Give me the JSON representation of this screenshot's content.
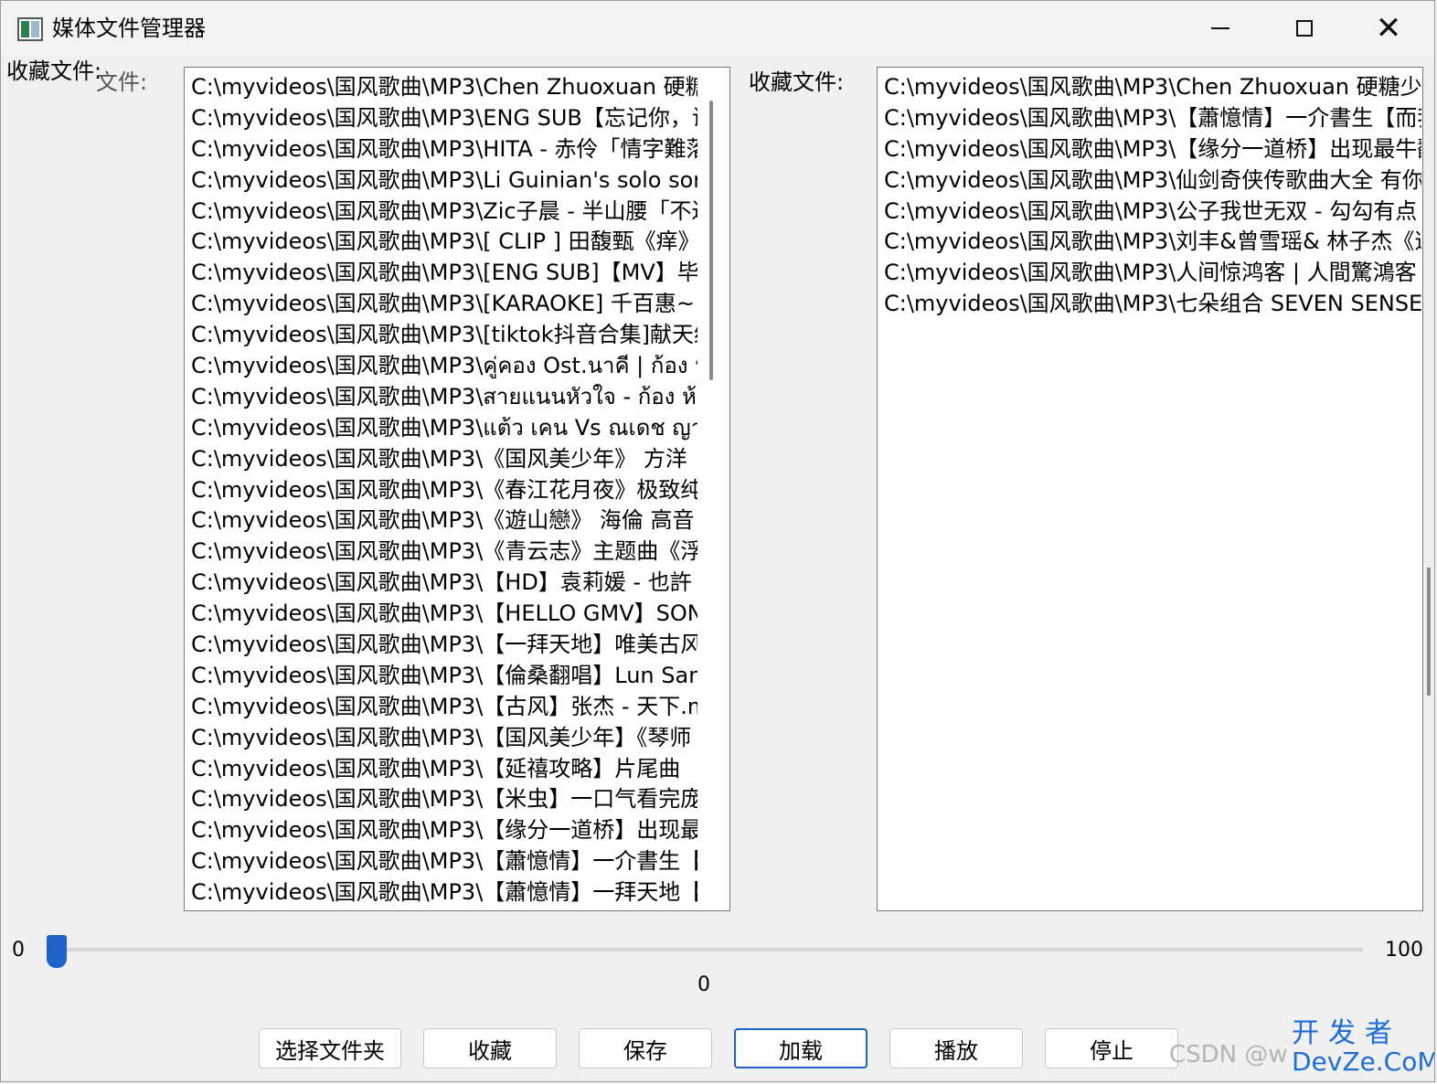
{
  "window": {
    "title": "媒体文件管理器",
    "minimize_label": "—",
    "maximize_label": "□",
    "close_label": "✕"
  },
  "left_panel": {
    "label": "收藏文件:",
    "label_ghost": "文件:",
    "items": [
      "C:\\myvideos\\国风歌曲\\MP3\\Chen Zhuoxuan 硬糖",
      "C:\\myvideos\\国风歌曲\\MP3\\ENG SUB【忘记你，说",
      "C:\\myvideos\\国风歌曲\\MP3\\HITA - 赤伶「情字難落",
      "C:\\myvideos\\国风歌曲\\MP3\\Li Guinian's solo son",
      "C:\\myvideos\\国风歌曲\\MP3\\Zic子晨 - 半山腰「不过",
      "C:\\myvideos\\国风歌曲\\MP3\\[ CLIP ] 田馥甄《痒》",
      "C:\\myvideos\\国风歌曲\\MP3\\[ENG SUB]【MV】毕",
      "C:\\myvideos\\国风歌曲\\MP3\\[KARAOKE] 千百惠~",
      "C:\\myvideos\\国风歌曲\\MP3\\[tiktok抖音合集]献天给",
      "C:\\myvideos\\国风歌曲\\MP3\\คู่คอง Ost.นาคี  |  ก้อง ห้",
      "C:\\myvideos\\国风歌曲\\MP3\\สายแนนหัวใจ - ก้อง ห้วยไร่",
      "C:\\myvideos\\国风歌曲\\MP3\\แต้ว เคน Vs ณเดช ญาญ่า",
      "C:\\myvideos\\国风歌曲\\MP3\\《国风美少年》  方洋",
      "C:\\myvideos\\国风歌曲\\MP3\\《春江花月夜》极致纯",
      "C:\\myvideos\\国风歌曲\\MP3\\《遊山戀》 海倫 高音",
      "C:\\myvideos\\国风歌曲\\MP3\\《青云志》主题曲《浮",
      "C:\\myvideos\\国风歌曲\\MP3\\【HD】袁莉媛 - 也許",
      "C:\\myvideos\\国风歌曲\\MP3\\【HELLO GMV】SON",
      "C:\\myvideos\\国风歌曲\\MP3\\【一拜天地】唯美古风",
      "C:\\myvideos\\国风歌曲\\MP3\\【倫桑翻唱】Lun San",
      "C:\\myvideos\\国风歌曲\\MP3\\【古风】张杰 - 天下.m",
      "C:\\myvideos\\国风歌曲\\MP3\\【国风美少年】《琴师",
      "C:\\myvideos\\国风歌曲\\MP3\\【延禧攻略】片尾曲",
      "C:\\myvideos\\国风歌曲\\MP3\\【米虫】一口气看完庞",
      "C:\\myvideos\\国风歌曲\\MP3\\【缘分一道桥】出现最",
      "C:\\myvideos\\国风歌曲\\MP3\\【蕭憶情】一介書生【",
      "C:\\myvideos\\国风歌曲\\MP3\\【蕭憶情】一拜天地【"
    ]
  },
  "right_panel": {
    "label": "收藏文件:",
    "items": [
      "C:\\myvideos\\国风歌曲\\MP3\\Chen Zhuoxuan 硬糖少女",
      "C:\\myvideos\\国风歌曲\\MP3\\【蕭憶情】一介書生【而我",
      "C:\\myvideos\\国风歌曲\\MP3\\【缘分一道桥】出现最牛翻",
      "C:\\myvideos\\国风歌曲\\MP3\\仙剑奇侠传歌曲大全 有你",
      "C:\\myvideos\\国风歌曲\\MP3\\公子我世无双 - 勾勾有点",
      "C:\\myvideos\\国风歌曲\\MP3\\刘丰&曾雪瑶& 林子杰《道",
      "C:\\myvideos\\国风歌曲\\MP3\\人间惊鸿客  |  人間驚鴻客",
      "C:\\myvideos\\国风歌曲\\MP3\\七朵组合 SEVEN SENSE"
    ]
  },
  "slider": {
    "min_label": "0",
    "max_label": "100",
    "value_label": "0",
    "value": 0
  },
  "buttons": {
    "select_folder": "选择文件夹",
    "favorite": "收藏",
    "save": "保存",
    "load": "加载",
    "play": "播放",
    "stop": "停止"
  },
  "watermark": {
    "csdn": "CSDN @w",
    "brand_line1": "开发者",
    "brand_line2": "DevZe.CoM"
  },
  "colors": {
    "accent": "#1d63c9",
    "background": "#f0f0f0",
    "list_background": "#ffffff"
  }
}
